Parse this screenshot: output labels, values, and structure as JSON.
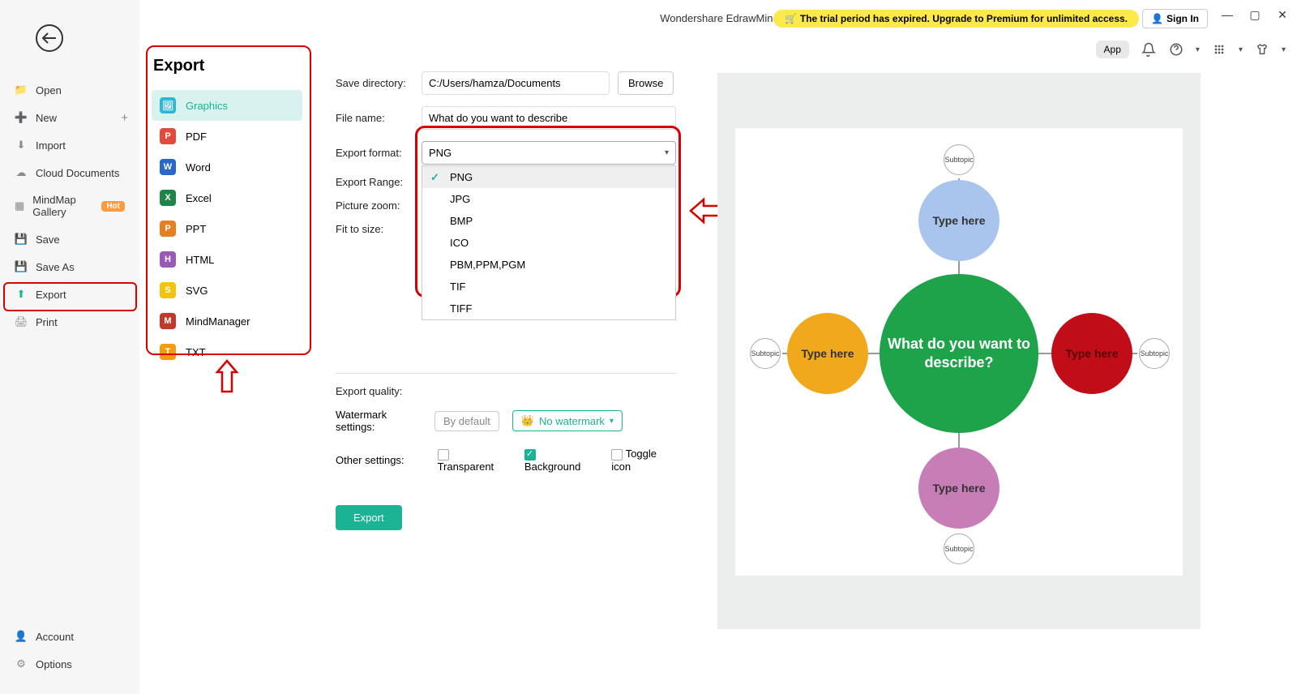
{
  "app_title": "Wondershare EdrawMind",
  "trial_msg": "The trial period has expired. Upgrade to Premium for unlimited access.",
  "signin": "Sign In",
  "app_pill": "App",
  "sidebar": {
    "items": [
      "Open",
      "New",
      "Import",
      "Cloud Documents",
      "MindMap Gallery",
      "Save",
      "Save As",
      "Export",
      "Print"
    ],
    "hot": "Hot",
    "bottom": [
      "Account",
      "Options"
    ]
  },
  "export": {
    "title": "Export",
    "types": [
      "Graphics",
      "PDF",
      "Word",
      "Excel",
      "PPT",
      "HTML",
      "SVG",
      "MindManager",
      "TXT"
    ]
  },
  "form": {
    "save_dir_label": "Save directory:",
    "save_dir": "C:/Users/hamza/Documents",
    "browse": "Browse",
    "filename_label": "File name:",
    "filename": "What do you want to describe",
    "format_label": "Export format:",
    "format_value": "PNG",
    "range_label": "Export Range:",
    "zoom_label": "Picture zoom:",
    "fit_label": "Fit to size:",
    "quality_label": "Export quality:",
    "watermark_label": "Watermark settings:",
    "wm_default": "By default",
    "wm_none": "No watermark",
    "other_label": "Other settings:",
    "transparent": "Transparent",
    "background": "Background",
    "toggle_icon": "Toggle icon",
    "export_btn": "Export",
    "formats": [
      "PNG",
      "JPG",
      "BMP",
      "ICO",
      "PBM,PPM,PGM",
      "TIF",
      "TIFF"
    ]
  },
  "mindmap": {
    "center": "What do you want to describe?",
    "branches": [
      "Type here",
      "Type here",
      "Type here",
      "Type here"
    ],
    "subtopic": "Subtopic"
  }
}
